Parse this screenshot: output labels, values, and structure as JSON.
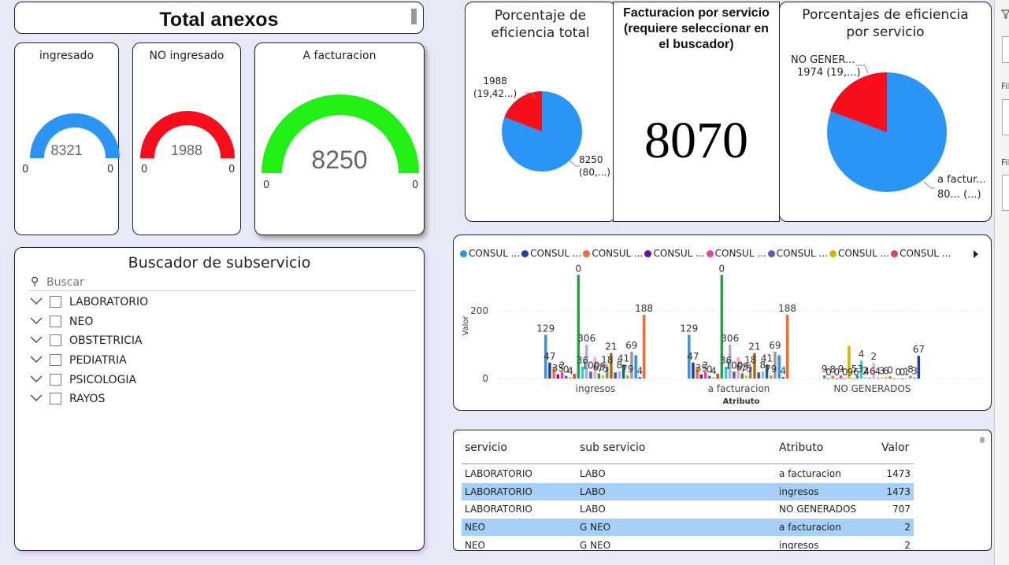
{
  "title": "Total anexos",
  "gauges": [
    {
      "label": "ingresado",
      "value": "8321",
      "min": "0",
      "max": "0",
      "color": "#2b95f5",
      "fill_fraction": 1.0
    },
    {
      "label": "NO ingresado",
      "value": "1988",
      "min": "0",
      "max": "0",
      "color": "#f80d1a",
      "fill_fraction": 1.0
    },
    {
      "label": "A facturacion",
      "value": "8250",
      "min": "0",
      "max": "0",
      "color": "#21f014",
      "fill_fraction": 1.0
    }
  ],
  "buscador": {
    "title": "Buscador de subservicio",
    "search_placeholder": "Buscar",
    "items": [
      "LABORATORIO",
      "NEO",
      "OBSTETRICIA",
      "PEDIATRIA",
      "PSICOLOGIA",
      "RAYOS"
    ]
  },
  "pct_total": {
    "title_line1": "Porcentaje de",
    "title_line2": "eficiencia total",
    "label_red_1": "1988",
    "label_red_2": "(19,42...)",
    "label_blue_1": "8250",
    "label_blue_2": "(80,...)"
  },
  "facturacion": {
    "title_line1": "Facturacion por servicio",
    "title_line2": "(requiere seleccionar en",
    "title_line3": "el buscador)",
    "value": "8070"
  },
  "pct_serv": {
    "title_line1": "Porcentajes de eficiencia",
    "title_line2": "por servicio",
    "label_red_1": "NO GENER...",
    "label_red_2": "1974 (19,...)",
    "label_blue_1": "a factur...",
    "label_blue_2": "80... (...)"
  },
  "colors": {
    "blue": "#2b95f5",
    "red": "#f80d1a",
    "green": "#21f014"
  },
  "chart_data": {
    "type": "bar",
    "legend": [
      {
        "name": "CONSUL ...",
        "color": "#2b95f5"
      },
      {
        "name": "CONSUL ...",
        "color": "#1f3ea8"
      },
      {
        "name": "CONSUL ...",
        "color": "#ee6e3a"
      },
      {
        "name": "CONSUL ...",
        "color": "#6b0f9e"
      },
      {
        "name": "CONSUL ...",
        "color": "#e044a7"
      },
      {
        "name": "CONSUL ...",
        "color": "#744ec2"
      },
      {
        "name": "CONSUL ...",
        "color": "#d9b300"
      },
      {
        "name": "CONSUL ...",
        "color": "#d64550"
      }
    ],
    "categories": [
      "ingresos",
      "a facturacion",
      "NO GENERADOS"
    ],
    "ylabel": "Valor",
    "xlabel": "Atributo",
    "yticks": [
      "0",
      "200"
    ],
    "ylim": [
      0,
      330
    ],
    "bar_colors": [
      "#2b95f5",
      "#1f3ea8",
      "#ee6e3a",
      "#6b0f9e",
      "#e044a7",
      "#744ec2",
      "#d9b300",
      "#d64550",
      "#1aab40",
      "#3ac9d6",
      "#9fb7e0",
      "#5d5d8c",
      "#f4a9c8",
      "#17a34a",
      "#d4c04e",
      "#7e8c99",
      "#b36b00",
      "#3559a6",
      "#c8a2e0",
      "#0f6e74",
      "#ec7e52",
      "#9a9a9a"
    ],
    "groups": [
      {
        "values": [
          129,
          47,
          35,
          12,
          20,
          8,
          4,
          14,
          306,
          35,
          100,
          20,
          63,
          15,
          10,
          36,
          75,
          18,
          21,
          41,
          9,
          79,
          69,
          4,
          188
        ],
        "labels": [
          "129",
          "47",
          "35",
          "2",
          "0",
          "4",
          "0",
          "36",
          "306",
          "100",
          "63",
          "75",
          "18",
          "21",
          "8",
          "41",
          "79",
          "69",
          "4",
          "188"
        ]
      },
      {
        "values": [
          129,
          47,
          35,
          12,
          20,
          8,
          4,
          14,
          306,
          35,
          100,
          20,
          63,
          15,
          10,
          36,
          75,
          18,
          21,
          41,
          9,
          79,
          69,
          4,
          188
        ],
        "labels": [
          "129",
          "47",
          "35",
          "2",
          "0",
          "4",
          "0",
          "36",
          "306",
          "100",
          "63",
          "75",
          "18",
          "21",
          "8",
          "41",
          "79",
          "69",
          "4",
          "188"
        ]
      },
      {
        "values": [
          9,
          0,
          8,
          0,
          9,
          0,
          96,
          0,
          9,
          53,
          4,
          2,
          46,
          2,
          4,
          3,
          6,
          0,
          0,
          0,
          1,
          8,
          3,
          67
        ],
        "labels": [
          "9",
          "0",
          "8",
          "0",
          "9",
          "0",
          "96",
          "53",
          "4",
          "2",
          "46",
          "2",
          "4",
          "3",
          "6",
          "0",
          "0",
          "0",
          "1",
          "8",
          "3",
          "67"
        ]
      }
    ]
  },
  "table": {
    "headers": [
      "servicio",
      "sub servicio",
      "Atributo",
      "Valor"
    ],
    "rows": [
      {
        "servicio": "LABORATORIO",
        "sub": "LABO",
        "atributo": "a facturacion",
        "valor": "1473",
        "selected": false
      },
      {
        "servicio": "LABORATORIO",
        "sub": "LABO",
        "atributo": "ingresos",
        "valor": "1473",
        "selected": true
      },
      {
        "servicio": "LABORATORIO",
        "sub": "LABO",
        "atributo": "NO GENERADOS",
        "valor": "707",
        "selected": false
      },
      {
        "servicio": "NEO",
        "sub": "G NEO",
        "atributo": "a facturacion",
        "valor": "2",
        "selected": true
      },
      {
        "servicio": "NEO",
        "sub": "G NEO",
        "atributo": "ingresos",
        "valor": "2",
        "selected": false
      }
    ]
  },
  "right_strip": {
    "label1": "Fil",
    "label2": "Fil"
  }
}
